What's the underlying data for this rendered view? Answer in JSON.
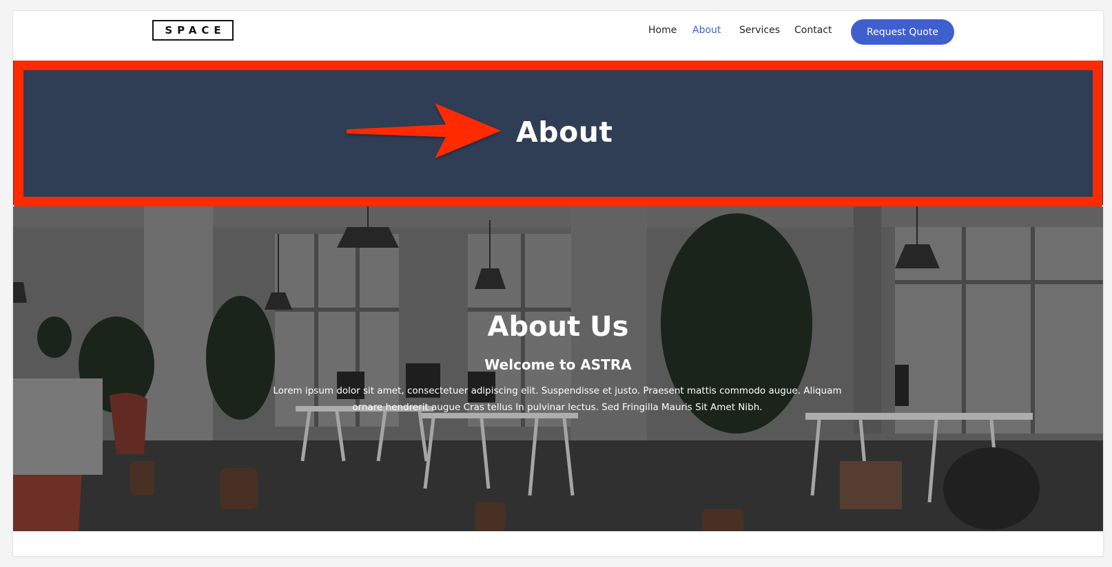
{
  "header": {
    "logo": "SPACE",
    "nav": [
      {
        "label": "Home"
      },
      {
        "label": "About",
        "active": true
      },
      {
        "label": "Services"
      },
      {
        "label": "Contact"
      }
    ],
    "cta_label": "Request Quote"
  },
  "title_banner": {
    "title": "About"
  },
  "hero": {
    "heading": "About Us",
    "subheading": "Welcome to ASTRA",
    "body": "Lorem ipsum dolor sit amet, consectetuer adipiscing elit. Suspendisse et justo. Praesent mattis commodo augue. Aliquam ornare hendrerit augue Cras tellus In pulvinar lectus. Sed Fringilla Mauris Sit Amet Nibh."
  },
  "colors": {
    "accent": "#3f5fcf",
    "banner": "#2f3e55",
    "highlight": "#ff2a00"
  }
}
